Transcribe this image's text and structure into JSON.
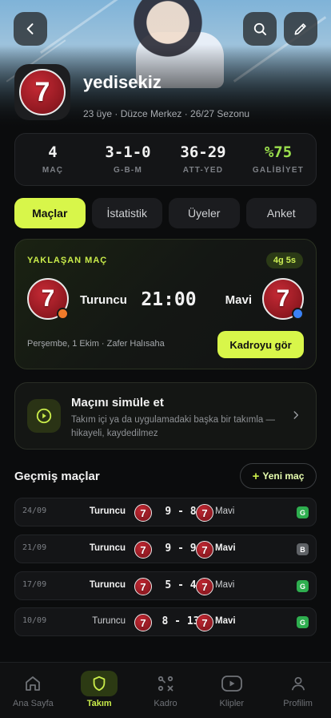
{
  "team": {
    "name": "yedisekiz",
    "subtitle": "23 üye · Düzce Merkez · 26/27 Sezonu",
    "logo_number": "7"
  },
  "stats": [
    {
      "value": "4",
      "label": "MAÇ",
      "color": "#f2f2f2"
    },
    {
      "value": "3-1-0",
      "label": "G-B-M",
      "color": "#f2f2f2"
    },
    {
      "value": "36-29",
      "label": "ATT-YED",
      "color": "#f2f2f2"
    },
    {
      "value": "%75",
      "label": "GALİBİYET",
      "color": "#9be04d"
    }
  ],
  "tabs": [
    {
      "label": "Maçlar",
      "active": true
    },
    {
      "label": "İstatistik",
      "active": false
    },
    {
      "label": "Üyeler",
      "active": false
    },
    {
      "label": "Anket",
      "active": false
    }
  ],
  "upcoming": {
    "label": "YAKLAŞAN MAÇ",
    "countdown": "4g 5s",
    "home": "Turuncu",
    "away": "Mavi",
    "time": "21:00",
    "home_color": "#f07a2a",
    "away_color": "#3b82f6",
    "info": "Perşembe, 1 Ekim · Zafer Halısaha",
    "button": "Kadroyu gör"
  },
  "simulate": {
    "title": "Maçını simüle et",
    "description": "Takım içi ya da uygulamadaki başka bir takımla — hikayeli, kaydedilmez"
  },
  "past": {
    "title": "Geçmiş maçlar",
    "new_button": "Yeni maç",
    "matches": [
      {
        "date": "24/09",
        "home": "Turuncu",
        "score": "9 - 8",
        "away": "Mavi",
        "result": "G",
        "result_color": "#2eae4f",
        "winner": "home"
      },
      {
        "date": "21/09",
        "home": "Turuncu",
        "score": "9 - 9",
        "away": "Mavi",
        "result": "B",
        "result_color": "#5f6266",
        "winner": "both"
      },
      {
        "date": "17/09",
        "home": "Turuncu",
        "score": "5 - 4",
        "away": "Mavi",
        "result": "G",
        "result_color": "#2eae4f",
        "winner": "home"
      },
      {
        "date": "10/09",
        "home": "Turuncu",
        "score": "8 - 13",
        "away": "Mavi",
        "result": "G",
        "result_color": "#2eae4f",
        "winner": "away"
      }
    ]
  },
  "nav": [
    {
      "label": "Ana Sayfa",
      "icon": "home-icon",
      "active": false
    },
    {
      "label": "Takım",
      "icon": "shield-icon",
      "active": true
    },
    {
      "label": "Kadro",
      "icon": "tactics-icon",
      "active": false
    },
    {
      "label": "Klipler",
      "icon": "play-icon",
      "active": false
    },
    {
      "label": "Profilim",
      "icon": "user-icon",
      "active": false
    }
  ],
  "colors": {
    "accent": "#d8f64a",
    "win": "#2eae4f",
    "draw": "#5f6266"
  }
}
